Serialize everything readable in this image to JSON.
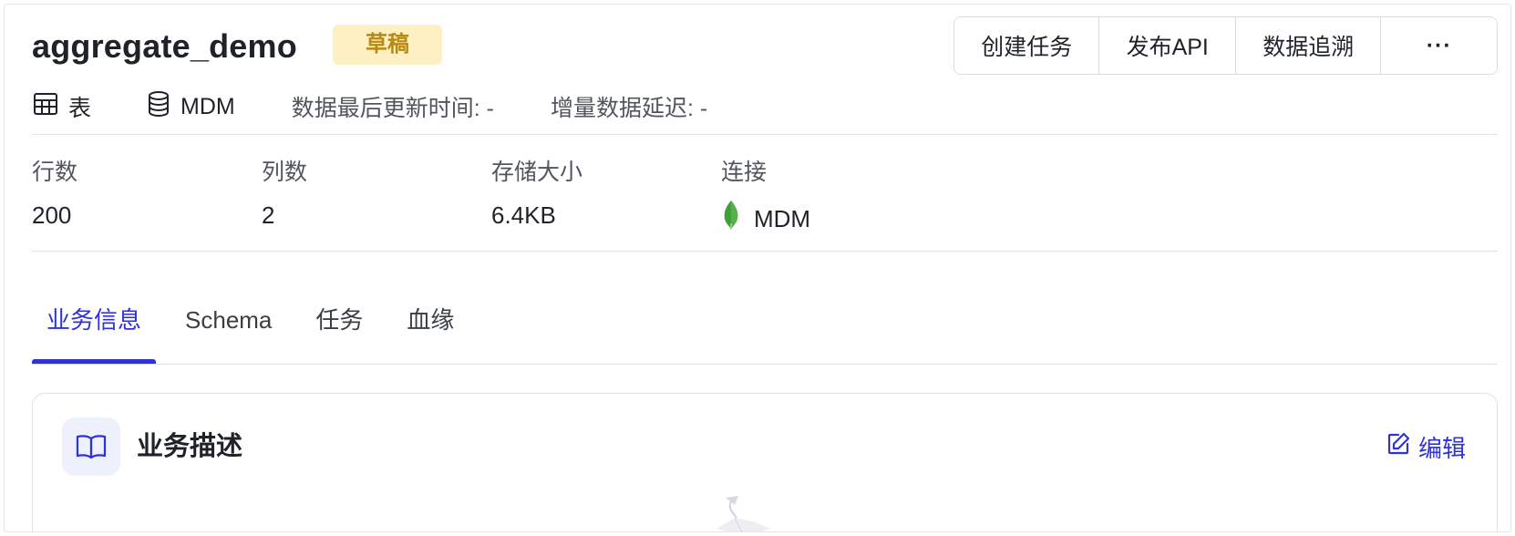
{
  "header": {
    "title": "aggregate_demo",
    "status_badge": "草稿",
    "actions": [
      "创建任务",
      "发布API",
      "数据追溯"
    ],
    "more_label": "···"
  },
  "meta": {
    "type_label": "表",
    "source_label": "MDM",
    "last_update": "数据最后更新时间: -",
    "incremental_delay": "增量数据延迟: -"
  },
  "stats": {
    "rows_label": "行数",
    "rows_value": "200",
    "columns_label": "列数",
    "columns_value": "2",
    "storage_label": "存储大小",
    "storage_value": "6.4KB",
    "connection_label": "连接",
    "connection_value": "MDM"
  },
  "tabs": [
    {
      "label": "业务信息",
      "active": true
    },
    {
      "label": "Schema",
      "active": false
    },
    {
      "label": "任务",
      "active": false
    },
    {
      "label": "血缘",
      "active": false
    }
  ],
  "card": {
    "title": "业务描述",
    "edit_label": "编辑"
  },
  "colors": {
    "accent": "#2f32d6",
    "badge_bg": "#fdf1c4",
    "badge_text": "#b98a12",
    "mongo_green": "#3fa037"
  },
  "icons": {
    "type": "table-icon",
    "source": "database-icon",
    "connection": "mongodb-leaf-icon",
    "card": "book-open-icon",
    "edit": "edit-icon"
  }
}
